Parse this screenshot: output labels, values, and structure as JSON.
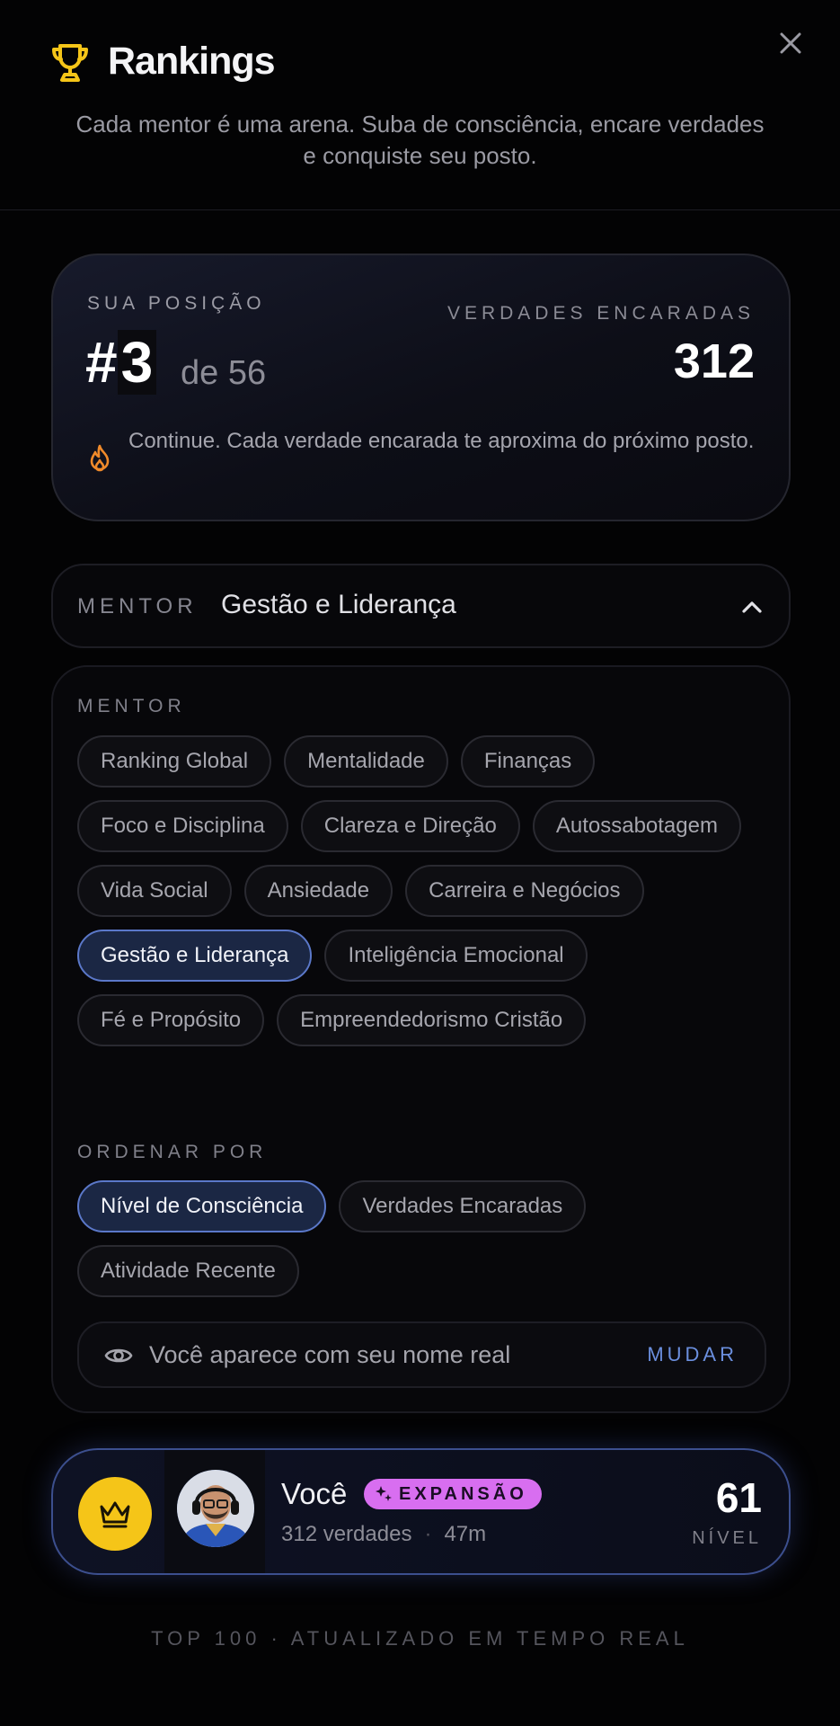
{
  "header": {
    "title": "Rankings",
    "subtitle": "Cada mentor é uma arena. Suba de consciência, encare verdades e conquiste seu posto.",
    "trophy_icon": "trophy-icon",
    "close_icon": "close-icon"
  },
  "position": {
    "label": "SUA POSIÇÃO",
    "rank_prefix": "#",
    "rank": "3",
    "of_text": "de 56",
    "truths_label": "VERDADES ENCARADAS",
    "truths_value": "312",
    "message": "Continue. Cada verdade encarada te aproxima do próximo posto.",
    "message_icon": "flame-icon"
  },
  "mentor_select": {
    "label": "MENTOR",
    "value": "Gestão e Liderança",
    "icon": "chevron-up-icon"
  },
  "filters": {
    "mentor_label": "MENTOR",
    "mentors": [
      {
        "label": "Ranking Global",
        "active": false
      },
      {
        "label": "Mentalidade",
        "active": false
      },
      {
        "label": "Finanças",
        "active": false
      },
      {
        "label": "Foco e Disciplina",
        "active": false
      },
      {
        "label": "Clareza e Direção",
        "active": false
      },
      {
        "label": "Autossabotagem",
        "active": false
      },
      {
        "label": "Vida Social",
        "active": false
      },
      {
        "label": "Ansiedade",
        "active": false
      },
      {
        "label": "Carreira e Negócios",
        "active": false
      },
      {
        "label": "Gestão e Liderança",
        "active": true
      },
      {
        "label": "Inteligência Emocional",
        "active": false
      },
      {
        "label": "Fé e Propósito",
        "active": false
      },
      {
        "label": "Empreendedorismo Cristão",
        "active": false
      }
    ],
    "sort_label": "ORDENAR POR",
    "sort_options": [
      {
        "label": "Nível de Consciência",
        "active": true
      },
      {
        "label": "Verdades Encaradas",
        "active": false
      },
      {
        "label": "Atividade Recente",
        "active": false
      }
    ],
    "visibility_text": "Você aparece com seu nome real",
    "visibility_action": "MUDAR",
    "visibility_icon": "eye-icon"
  },
  "me": {
    "name": "Você",
    "tier": "EXPANSÃO",
    "tier_icon": "sparkle-icon",
    "badge_icon": "crown-icon",
    "truths": "312 verdades",
    "separator": "·",
    "time": "47m",
    "level_value": "61",
    "level_label": "NÍVEL"
  },
  "footer": "TOP 100 · ATUALIZADO EM TEMPO REAL",
  "colors": {
    "background": "#030304",
    "accent_gold": "#f5c518",
    "accent_blue": "#5b78c9",
    "tier_pink": "#d86ef0",
    "flame": "#f08a2a"
  }
}
